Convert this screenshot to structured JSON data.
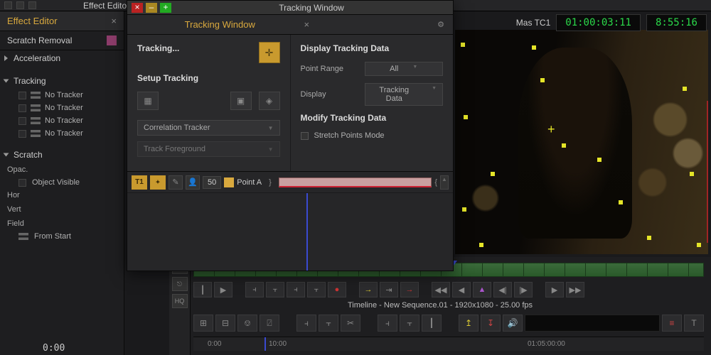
{
  "app": {
    "top_label": "Effect Editor"
  },
  "effect_editor": {
    "title": "Effect Editor",
    "section": "Scratch Removal",
    "groups": {
      "acceleration": "Acceleration",
      "tracking": "Tracking",
      "scratch": "Scratch"
    },
    "trackers": [
      "No Tracker",
      "No Tracker",
      "No Tracker",
      "No Tracker"
    ],
    "opacity_label": "Opac.",
    "object_visible": "Object Visible",
    "hor": "Hor",
    "vert": "Vert",
    "field": "Field",
    "from_start": "From Start",
    "bottom_tc": "0:00"
  },
  "timecode": {
    "label": "Mas TC1",
    "main": "01:00:03:11",
    "dur": "8:55:16"
  },
  "tracking_window": {
    "titlebar": "Tracking Window",
    "subtitle": "Tracking Window",
    "status": "Tracking...",
    "setup_header": "Setup Tracking",
    "tracker_type": "Correlation Tracker",
    "track_target": "Track Foreground",
    "display_header": "Display Tracking Data",
    "point_range_label": "Point Range",
    "point_range_value": "All",
    "display_label": "Display",
    "display_value": "Tracking Data",
    "modify_header": "Modify Tracking Data",
    "stretch_label": "Stretch Points Mode",
    "t1": "T1",
    "num": "50",
    "point_label": "Point A"
  },
  "timeline": {
    "label": "Timeline - New Sequence.01 - 1920x1080 - 25.00 fps",
    "hq": "HQ",
    "ruler_t0": "0:00",
    "ruler_t1": "10:00",
    "ruler_t2": "01:05:00:00"
  },
  "icons": {
    "close": "×",
    "min": "–",
    "max": "+",
    "gear": "⚙",
    "play": "▶",
    "back": "◀",
    "pipe": "┃",
    "db": "⫞",
    "split": "⫟",
    "red": "●",
    "mk1": "→",
    "mk2": "⇥",
    "rw": "◀◀",
    "ff": "▶▶",
    "up": "▲",
    "stepb": "◀|",
    "stepf": "|▶",
    "ins": "⊞",
    "ext": "⊟",
    "lift": "⎊",
    "ovw": "⍁",
    "spl": "✂",
    "a1": "↥",
    "a2": "↧",
    "vol": "🔊",
    "menu": "≡",
    "txt": "T",
    "link": "⎋",
    "sync": "⟲",
    "target": "✛",
    "person": "👤",
    "graph": "✎"
  }
}
